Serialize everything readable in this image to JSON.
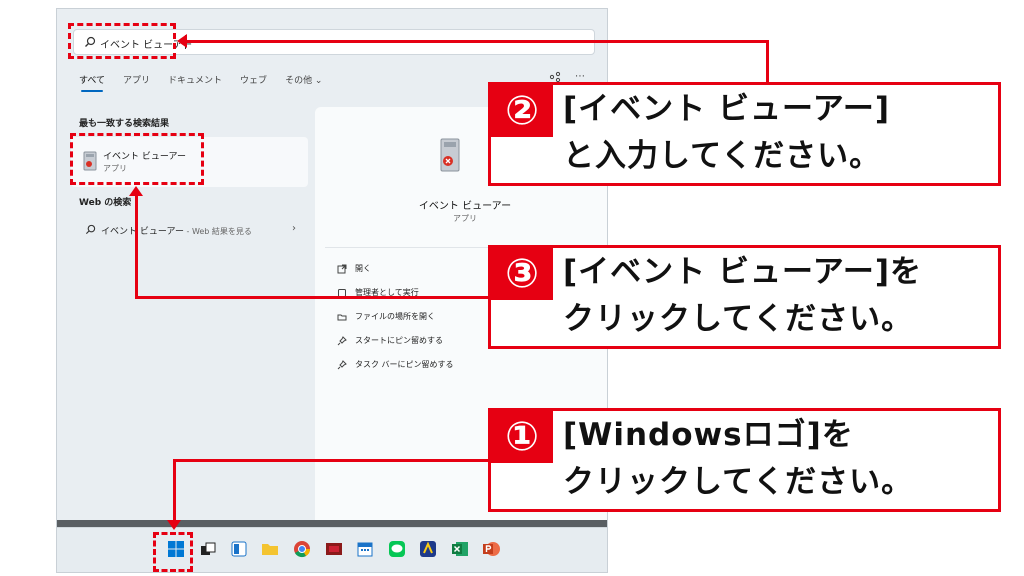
{
  "search": {
    "query": "イベント ビューアー"
  },
  "tabs": [
    "すべて",
    "アプリ",
    "ドキュメント",
    "ウェブ",
    "その他 ⌄"
  ],
  "tab_extras": [
    "⋯"
  ],
  "best_match": {
    "heading": "最も一致する検索結果",
    "title": "イベント ビューアー",
    "subtitle": "アプリ"
  },
  "web_search": {
    "heading": "Web の検索",
    "query": "イベント ビューアー",
    "suffix": " - Web 結果を見る",
    "chevron": "›"
  },
  "detail": {
    "title": "イベント ビューアー",
    "subtitle": "アプリ",
    "actions": [
      "開く",
      "管理者として実行",
      "ファイルの場所を開く",
      "スタートにピン留めする",
      "タスク バーにピン留めする"
    ]
  },
  "callouts": [
    {
      "badge": "②",
      "lines": [
        "[イベント ビューアー]",
        "と入力してください。"
      ]
    },
    {
      "badge": "③",
      "lines": [
        "[イベント ビューアー]を",
        "クリックしてください。"
      ]
    },
    {
      "badge": "①",
      "lines": [
        "[Windowsロゴ]を",
        "クリックしてください。"
      ]
    }
  ],
  "taskbar_icons": [
    "windows-start-icon",
    "task-view-icon",
    "widgets-icon",
    "file-explorer-icon",
    "chrome-icon",
    "app-icon",
    "calendar-icon",
    "line-icon",
    "app2-icon",
    "excel-icon",
    "powerpoint-icon"
  ],
  "colors": {
    "accent_red": "#e60012",
    "windows_blue": "#0078d4"
  }
}
